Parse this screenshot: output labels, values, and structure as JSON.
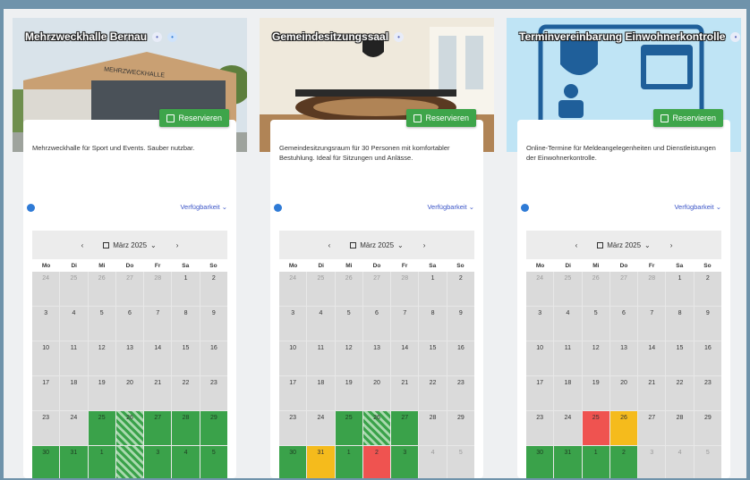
{
  "calendar_common": {
    "weekdays": [
      "Mo",
      "Di",
      "Mi",
      "Do",
      "Fr",
      "Sa",
      "So"
    ],
    "month_label": "März 2025",
    "prev": "‹",
    "next": "›",
    "dropdown": "⌄"
  },
  "cards": [
    {
      "title": "Mehrzweckhalle Bernau",
      "description": "Mehrzweckhalle für Sport und Events. Sauber nutzbar.",
      "reserve_label": "Reservieren",
      "availability_label": "Verfügbarkeit ⌄",
      "banner_text": "MEHRZWECKHALLE",
      "days": [
        {
          "n": "24",
          "s": "muted"
        },
        {
          "n": "25",
          "s": "muted"
        },
        {
          "n": "26",
          "s": "muted"
        },
        {
          "n": "27",
          "s": "muted"
        },
        {
          "n": "28",
          "s": "muted"
        },
        {
          "n": "1",
          "s": ""
        },
        {
          "n": "2",
          "s": ""
        },
        {
          "n": "3",
          "s": ""
        },
        {
          "n": "4",
          "s": ""
        },
        {
          "n": "5",
          "s": ""
        },
        {
          "n": "6",
          "s": ""
        },
        {
          "n": "7",
          "s": ""
        },
        {
          "n": "8",
          "s": ""
        },
        {
          "n": "9",
          "s": ""
        },
        {
          "n": "10",
          "s": ""
        },
        {
          "n": "11",
          "s": ""
        },
        {
          "n": "12",
          "s": ""
        },
        {
          "n": "13",
          "s": ""
        },
        {
          "n": "14",
          "s": ""
        },
        {
          "n": "15",
          "s": ""
        },
        {
          "n": "16",
          "s": ""
        },
        {
          "n": "17",
          "s": ""
        },
        {
          "n": "18",
          "s": ""
        },
        {
          "n": "19",
          "s": ""
        },
        {
          "n": "20",
          "s": ""
        },
        {
          "n": "21",
          "s": ""
        },
        {
          "n": "22",
          "s": ""
        },
        {
          "n": "23",
          "s": ""
        },
        {
          "n": "23",
          "s": ""
        },
        {
          "n": "24",
          "s": ""
        },
        {
          "n": "25",
          "s": "free"
        },
        {
          "n": "26",
          "s": "stripe"
        },
        {
          "n": "27",
          "s": "free"
        },
        {
          "n": "28",
          "s": "free"
        },
        {
          "n": "29",
          "s": "free"
        },
        {
          "n": "30",
          "s": "free"
        },
        {
          "n": "31",
          "s": "free"
        },
        {
          "n": "1",
          "s": "free"
        },
        {
          "n": "",
          "s": "stripe"
        },
        {
          "n": "3",
          "s": "free"
        },
        {
          "n": "4",
          "s": "free"
        },
        {
          "n": "5",
          "s": "free"
        }
      ]
    },
    {
      "title": "Gemeindesitzungssaal",
      "description": "Gemeindesitzungsraum für 30 Personen mit komfortabler Bestuhlung. Ideal für Sitzungen und Anlässe.",
      "reserve_label": "Reservieren",
      "availability_label": "Verfügbarkeit ⌄",
      "days": [
        {
          "n": "24",
          "s": "muted"
        },
        {
          "n": "25",
          "s": "muted"
        },
        {
          "n": "26",
          "s": "muted"
        },
        {
          "n": "27",
          "s": "muted"
        },
        {
          "n": "28",
          "s": "muted"
        },
        {
          "n": "1",
          "s": ""
        },
        {
          "n": "2",
          "s": ""
        },
        {
          "n": "3",
          "s": ""
        },
        {
          "n": "4",
          "s": ""
        },
        {
          "n": "5",
          "s": ""
        },
        {
          "n": "6",
          "s": ""
        },
        {
          "n": "7",
          "s": ""
        },
        {
          "n": "8",
          "s": ""
        },
        {
          "n": "9",
          "s": ""
        },
        {
          "n": "10",
          "s": ""
        },
        {
          "n": "11",
          "s": ""
        },
        {
          "n": "12",
          "s": ""
        },
        {
          "n": "13",
          "s": ""
        },
        {
          "n": "14",
          "s": ""
        },
        {
          "n": "15",
          "s": ""
        },
        {
          "n": "16",
          "s": ""
        },
        {
          "n": "17",
          "s": ""
        },
        {
          "n": "18",
          "s": ""
        },
        {
          "n": "19",
          "s": ""
        },
        {
          "n": "20",
          "s": ""
        },
        {
          "n": "21",
          "s": ""
        },
        {
          "n": "22",
          "s": ""
        },
        {
          "n": "23",
          "s": ""
        },
        {
          "n": "23",
          "s": ""
        },
        {
          "n": "24",
          "s": ""
        },
        {
          "n": "25",
          "s": "free"
        },
        {
          "n": "26",
          "s": "stripe"
        },
        {
          "n": "27",
          "s": "free"
        },
        {
          "n": "28",
          "s": ""
        },
        {
          "n": "29",
          "s": ""
        },
        {
          "n": "30",
          "s": "free"
        },
        {
          "n": "31",
          "s": "part"
        },
        {
          "n": "1",
          "s": "free"
        },
        {
          "n": "2",
          "s": "busy"
        },
        {
          "n": "3",
          "s": "free"
        },
        {
          "n": "4",
          "s": "muted"
        },
        {
          "n": "5",
          "s": "muted"
        }
      ]
    },
    {
      "title": "Terminvereinbarung Einwohnerkontrolle",
      "description": "Online-Termine für Meldeangelegenheiten und Dienstleistungen der Einwohnerkontrolle.",
      "reserve_label": "Reservieren",
      "availability_label": "Verfügbarkeit ⌄",
      "days": [
        {
          "n": "24",
          "s": "muted"
        },
        {
          "n": "25",
          "s": "muted"
        },
        {
          "n": "26",
          "s": "muted"
        },
        {
          "n": "27",
          "s": "muted"
        },
        {
          "n": "28",
          "s": "muted"
        },
        {
          "n": "1",
          "s": ""
        },
        {
          "n": "2",
          "s": ""
        },
        {
          "n": "3",
          "s": ""
        },
        {
          "n": "4",
          "s": ""
        },
        {
          "n": "5",
          "s": ""
        },
        {
          "n": "6",
          "s": ""
        },
        {
          "n": "7",
          "s": ""
        },
        {
          "n": "8",
          "s": ""
        },
        {
          "n": "9",
          "s": ""
        },
        {
          "n": "10",
          "s": ""
        },
        {
          "n": "11",
          "s": ""
        },
        {
          "n": "12",
          "s": ""
        },
        {
          "n": "13",
          "s": ""
        },
        {
          "n": "14",
          "s": ""
        },
        {
          "n": "15",
          "s": ""
        },
        {
          "n": "16",
          "s": ""
        },
        {
          "n": "17",
          "s": ""
        },
        {
          "n": "18",
          "s": ""
        },
        {
          "n": "19",
          "s": ""
        },
        {
          "n": "20",
          "s": ""
        },
        {
          "n": "21",
          "s": ""
        },
        {
          "n": "22",
          "s": ""
        },
        {
          "n": "23",
          "s": ""
        },
        {
          "n": "23",
          "s": ""
        },
        {
          "n": "24",
          "s": ""
        },
        {
          "n": "25",
          "s": "busy"
        },
        {
          "n": "26",
          "s": "part"
        },
        {
          "n": "27",
          "s": ""
        },
        {
          "n": "28",
          "s": ""
        },
        {
          "n": "29",
          "s": ""
        },
        {
          "n": "30",
          "s": "free"
        },
        {
          "n": "31",
          "s": "free"
        },
        {
          "n": "1",
          "s": "free"
        },
        {
          "n": "2",
          "s": "free"
        },
        {
          "n": "3",
          "s": "muted"
        },
        {
          "n": "4",
          "s": "muted"
        },
        {
          "n": "5",
          "s": "muted"
        }
      ]
    }
  ]
}
